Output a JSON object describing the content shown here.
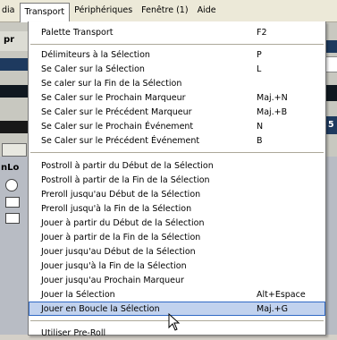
{
  "menubar": {
    "items": [
      "dia",
      "Transport",
      "Périphériques",
      "Fenêtre (1)",
      "Aide"
    ]
  },
  "left_app": {
    "label_top": "pr",
    "label_mid": "nLo"
  },
  "right_app": {
    "label_mid": "5"
  },
  "transport_menu": {
    "groups": [
      [
        {
          "label": "Palette Transport",
          "shortcut": "F2"
        }
      ],
      [
        {
          "label": "Délimiteurs à la Sélection",
          "shortcut": "P"
        },
        {
          "label": "Se Caler sur la Sélection",
          "shortcut": "L"
        },
        {
          "label": "Se caler sur la Fin de la Sélection",
          "shortcut": ""
        },
        {
          "label": "Se Caler sur le Prochain Marqueur",
          "shortcut": "Maj.+N"
        },
        {
          "label": "Se Caler sur le Précédent Marqueur",
          "shortcut": "Maj.+B"
        },
        {
          "label": "Se Caler sur le Prochain Événement",
          "shortcut": "N"
        },
        {
          "label": "Se Caler sur le Précédent Événement",
          "shortcut": "B"
        }
      ],
      [
        {
          "label": "Postroll à partir du Début de la Sélection",
          "shortcut": ""
        },
        {
          "label": "Postroll à partir de la Fin de la Sélection",
          "shortcut": ""
        },
        {
          "label": "Preroll jusqu'au Début de la Sélection",
          "shortcut": ""
        },
        {
          "label": "Preroll jusqu'à la Fin de la Sélection",
          "shortcut": ""
        },
        {
          "label": "Jouer à partir du Début de la Sélection",
          "shortcut": ""
        },
        {
          "label": "Jouer à partir de la Fin de la Sélection",
          "shortcut": ""
        },
        {
          "label": "Jouer jusqu'au Début de la Sélection",
          "shortcut": ""
        },
        {
          "label": "Jouer jusqu'à la Fin de la Sélection",
          "shortcut": ""
        },
        {
          "label": "Jouer jusqu'au Prochain Marqueur",
          "shortcut": ""
        },
        {
          "label": "Jouer la Sélection",
          "shortcut": "Alt+Espace"
        },
        {
          "label": "Jouer en Boucle la Sélection",
          "shortcut": "Maj.+G",
          "highlighted": true
        }
      ]
    ],
    "partial_item": "Utiliser Pre-Roll"
  },
  "colors": {
    "menu_highlight": "#c1d2ee",
    "menu_highlight_border": "#316ac5",
    "menubar_bg": "#ece9d8"
  }
}
